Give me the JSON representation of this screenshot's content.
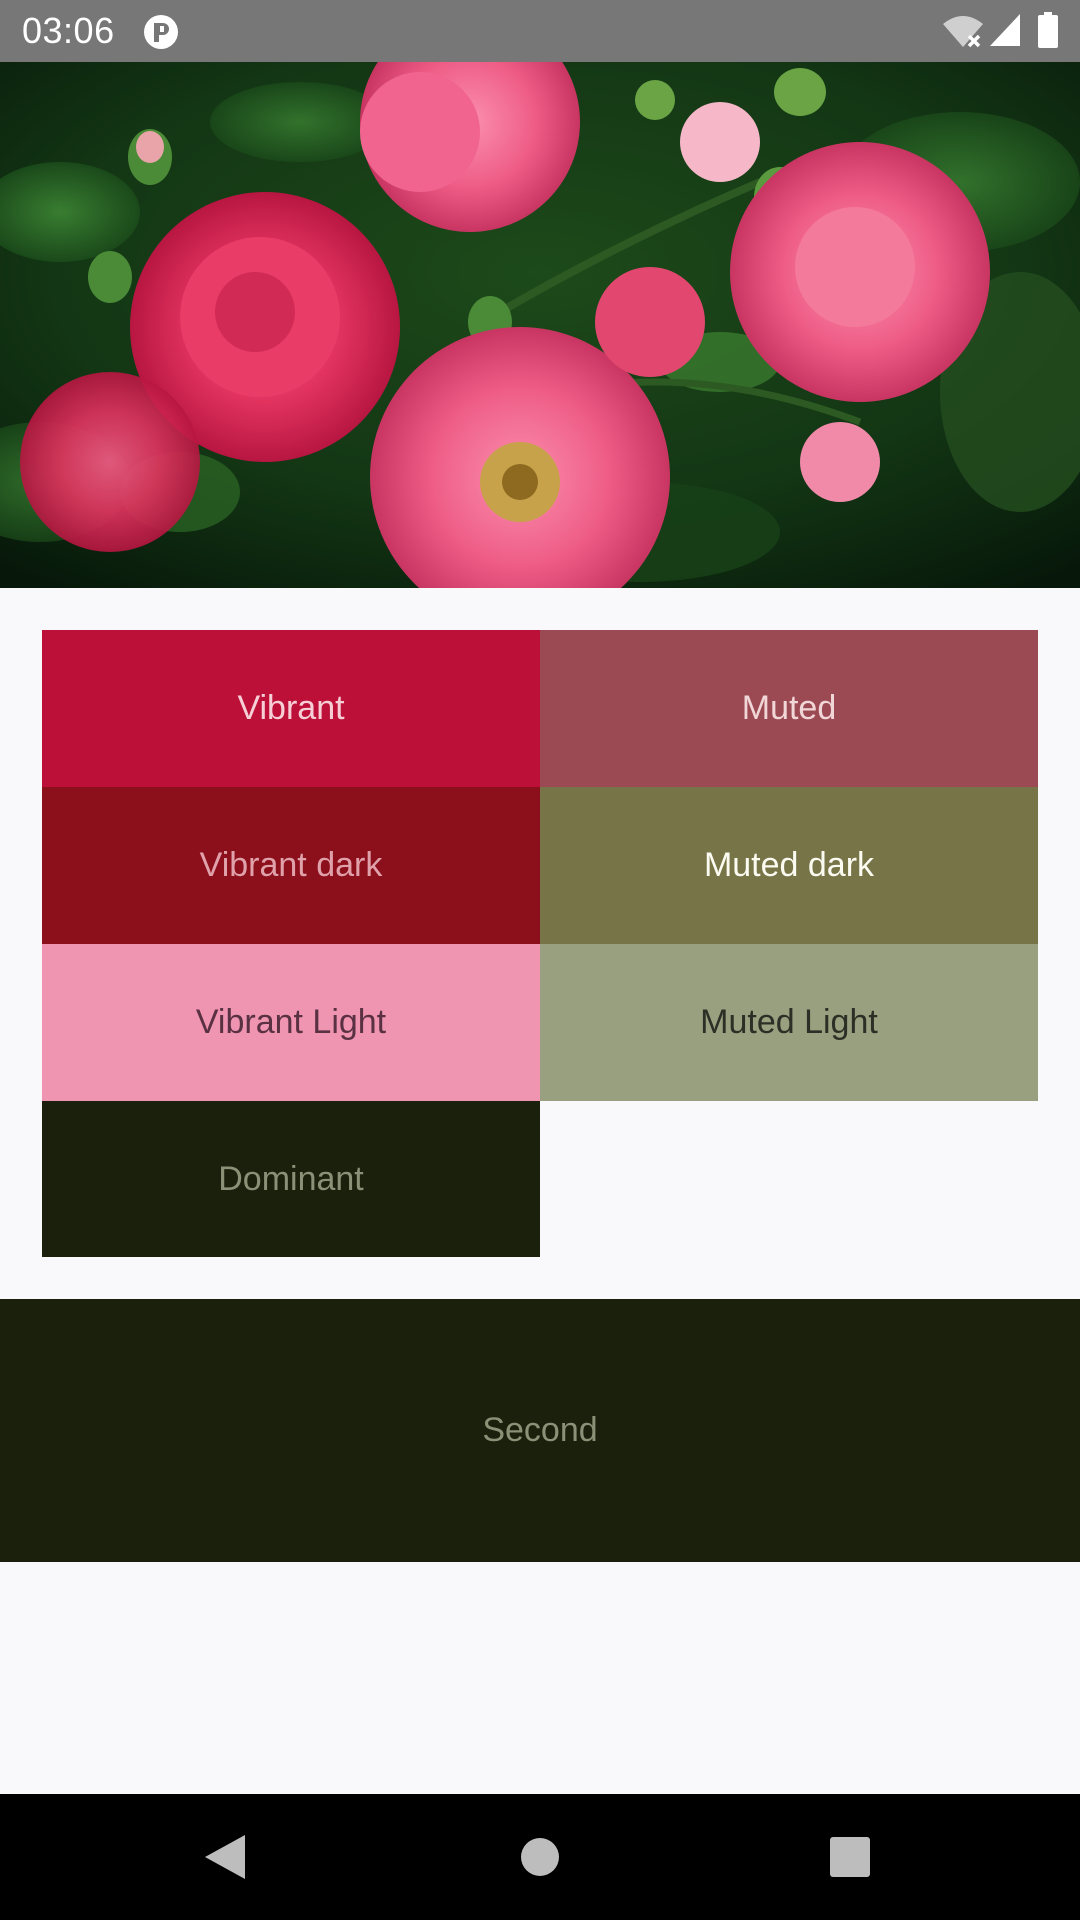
{
  "status_bar": {
    "time": "03:06",
    "icons": [
      "app-badge-icon",
      "wifi-off-icon",
      "signal-icon",
      "battery-icon"
    ]
  },
  "hero_image": {
    "subject": "pink roses with green foliage"
  },
  "palette": {
    "vibrant": {
      "label": "Vibrant",
      "bg": "#bc1038",
      "fg": "#f6cfd6"
    },
    "muted": {
      "label": "Muted",
      "bg": "#9b4952",
      "fg": "#f1d6d8"
    },
    "vibrant_dark": {
      "label": "Vibrant dark",
      "bg": "#8c0f1c",
      "fg": "#e0a2aa"
    },
    "muted_dark": {
      "label": "Muted dark",
      "bg": "#777448",
      "fg": "#fbfbf2"
    },
    "vibrant_light": {
      "label": "Vibrant Light",
      "bg": "#ef95b2",
      "fg": "#5a3142"
    },
    "muted_light": {
      "label": "Muted Light",
      "bg": "#99a07f",
      "fg": "#2c2f25"
    },
    "dominant": {
      "label": "Dominant",
      "bg": "#1b200d",
      "fg": "#8b9177"
    }
  },
  "second": {
    "label": "Second",
    "bg": "#1b200d",
    "fg": "#8b9177"
  },
  "nav_bar": {
    "icons": [
      "back-icon",
      "home-icon",
      "recents-icon"
    ]
  }
}
